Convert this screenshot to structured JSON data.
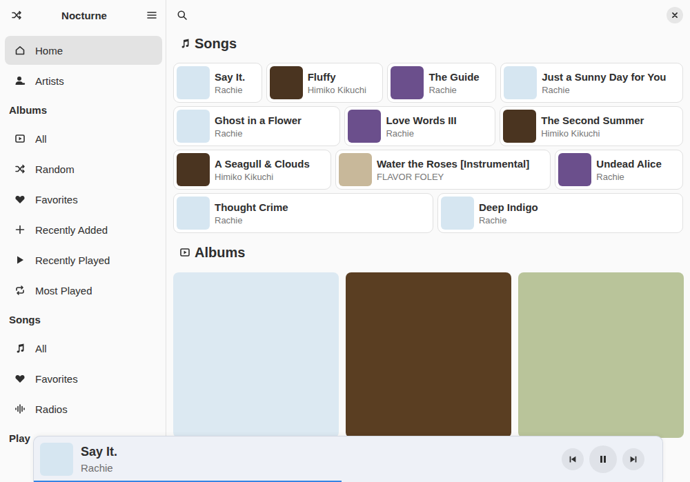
{
  "window": {
    "title": "Nocturne"
  },
  "sidebar": {
    "top": [
      {
        "label": "Home",
        "selected": true
      },
      {
        "label": "Artists",
        "selected": false
      }
    ],
    "groups": [
      {
        "title": "Albums",
        "items": [
          {
            "label": "All",
            "selected": false
          },
          {
            "label": "Random",
            "selected": false
          },
          {
            "label": "Favorites",
            "selected": false
          },
          {
            "label": "Recently Added",
            "selected": false
          },
          {
            "label": "Recently Played",
            "selected": false
          },
          {
            "label": "Most Played",
            "selected": false
          }
        ]
      },
      {
        "title": "Songs",
        "items": [
          {
            "label": "All",
            "selected": false
          },
          {
            "label": "Favorites",
            "selected": false
          },
          {
            "label": "Radios",
            "selected": false
          }
        ]
      },
      {
        "title": "Play",
        "items": []
      }
    ]
  },
  "songs_section": {
    "title": "Songs"
  },
  "songs": [
    {
      "title": "Say It.",
      "artist": "Rachie",
      "color": "#d6e6f1"
    },
    {
      "title": "Fluffy",
      "artist": "Himiko Kikuchi",
      "color": "#4a3420"
    },
    {
      "title": "The Guide",
      "artist": "Rachie",
      "color": "#6b4f8c"
    },
    {
      "title": "Just a Sunny Day for You",
      "artist": "Rachie",
      "color": "#d6e6f1"
    },
    {
      "title": "Ghost in a Flower",
      "artist": "Rachie",
      "color": "#d6e6f1"
    },
    {
      "title": "Love Words III",
      "artist": "Rachie",
      "color": "#6b4f8c"
    },
    {
      "title": "The Second Summer",
      "artist": "Himiko Kikuchi",
      "color": "#4a3420"
    },
    {
      "title": "A Seagull & Clouds",
      "artist": "Himiko Kikuchi",
      "color": "#4a3420"
    },
    {
      "title": "Water the Roses [Instrumental]",
      "artist": "FLAVOR FOLEY",
      "color": "#c8b89a"
    },
    {
      "title": "Undead Alice",
      "artist": "Rachie",
      "color": "#6b4f8c"
    },
    {
      "title": "Thought Crime",
      "artist": "Rachie",
      "color": "#d6e6f1"
    },
    {
      "title": "Deep Indigo",
      "artist": "Rachie",
      "color": "#d6e6f1"
    }
  ],
  "albums_section": {
    "title": "Albums"
  },
  "albums": [
    {
      "color": "#dce9f2"
    },
    {
      "color": "#5a3e22"
    },
    {
      "color": "#b9c49a"
    }
  ],
  "player": {
    "title": "Say It.",
    "artist": "Rachie",
    "color": "#d6e6f1",
    "playing": true,
    "level": 0.49
  }
}
